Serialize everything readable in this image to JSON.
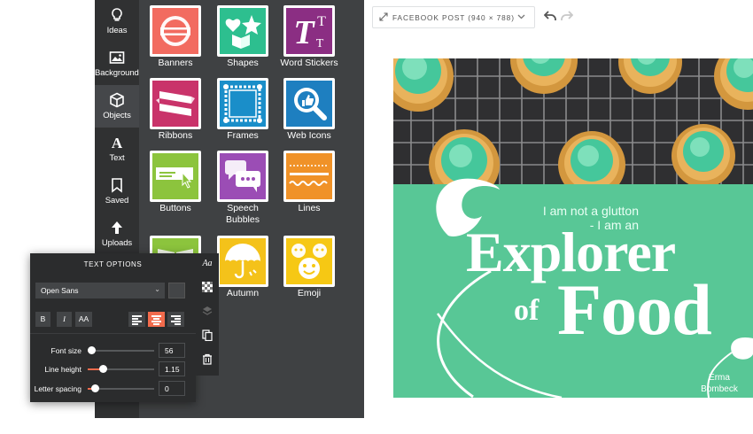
{
  "sidebar": {
    "items": [
      {
        "label": "Ideas",
        "icon": "lightbulb-icon"
      },
      {
        "label": "Backgrounds",
        "icon": "image-icon"
      },
      {
        "label": "Objects",
        "icon": "cube-icon",
        "active": true
      },
      {
        "label": "Text",
        "icon": "text-icon"
      },
      {
        "label": "Saved",
        "icon": "bookmark-icon"
      },
      {
        "label": "Uploads",
        "icon": "upload-arrow-icon"
      }
    ]
  },
  "objects_panel": {
    "tiles": [
      {
        "label": "Banners",
        "color": "#f26b60",
        "icon": "badge-banner-icon"
      },
      {
        "label": "Shapes",
        "color": "#2dbf8f",
        "icon": "heart-star-shapes-icon"
      },
      {
        "label": "Word Stickers",
        "color": "#8b2e83",
        "icon": "letter-t-icon"
      },
      {
        "label": "Ribbons",
        "color": "#c9336a",
        "icon": "ribbon-icon"
      },
      {
        "label": "Frames",
        "color": "#1a8ec9",
        "icon": "frame-icon"
      },
      {
        "label": "Web Icons",
        "color": "#1e7fc0",
        "icon": "magnifier-thumbs-up-icon"
      },
      {
        "label": "Buttons",
        "color": "#8cc43d",
        "icon": "cursor-button-icon"
      },
      {
        "label": "Speech\nBubbles",
        "label_line1": "Speech",
        "label_line2": "Bubbles",
        "color": "#9b4db5",
        "icon": "speech-bubble-icon"
      },
      {
        "label": "Lines",
        "color": "#f09228",
        "icon": "dotted-lines-icon"
      },
      {
        "label": "",
        "color": "#8cc43d",
        "icon": "book-icon"
      },
      {
        "label": "Autumn",
        "color": "#f4c21a",
        "icon": "umbrella-icon"
      },
      {
        "label": "Emoji",
        "color": "#f6c814",
        "icon": "emoji-faces-icon"
      }
    ]
  },
  "text_options": {
    "title": "TEXT OPTIONS",
    "font_family": "Open Sans",
    "format_buttons": [
      "B",
      "I",
      "AA"
    ],
    "alignment": [
      "left",
      "center",
      "right"
    ],
    "active_alignment": "center",
    "accent_color": "#f26b4c",
    "sliders": [
      {
        "label": "Font size",
        "value": "56",
        "level": 0.05
      },
      {
        "label": "Line height",
        "value": "1.15",
        "level": 0.22
      },
      {
        "label": "Letter spacing",
        "value": "0",
        "level": 0.1
      }
    ]
  },
  "toolbar": {
    "aa_label": "Aa",
    "tools": [
      "transparency-checker-icon",
      "layers-icon",
      "duplicate-icon",
      "trash-icon"
    ]
  },
  "topbar": {
    "size_label": "FACEBOOK POST (940 × 788)",
    "undo": "undo-icon",
    "redo": "redo-icon"
  },
  "canvas": {
    "background": "#58c796",
    "quote_line1": "I am not a glutton",
    "quote_line2": "- I am an",
    "headline_1": "Explorer",
    "headline_of": "of",
    "headline_2": "Food",
    "author_first": "Erma",
    "author_last": "Bombeck"
  }
}
